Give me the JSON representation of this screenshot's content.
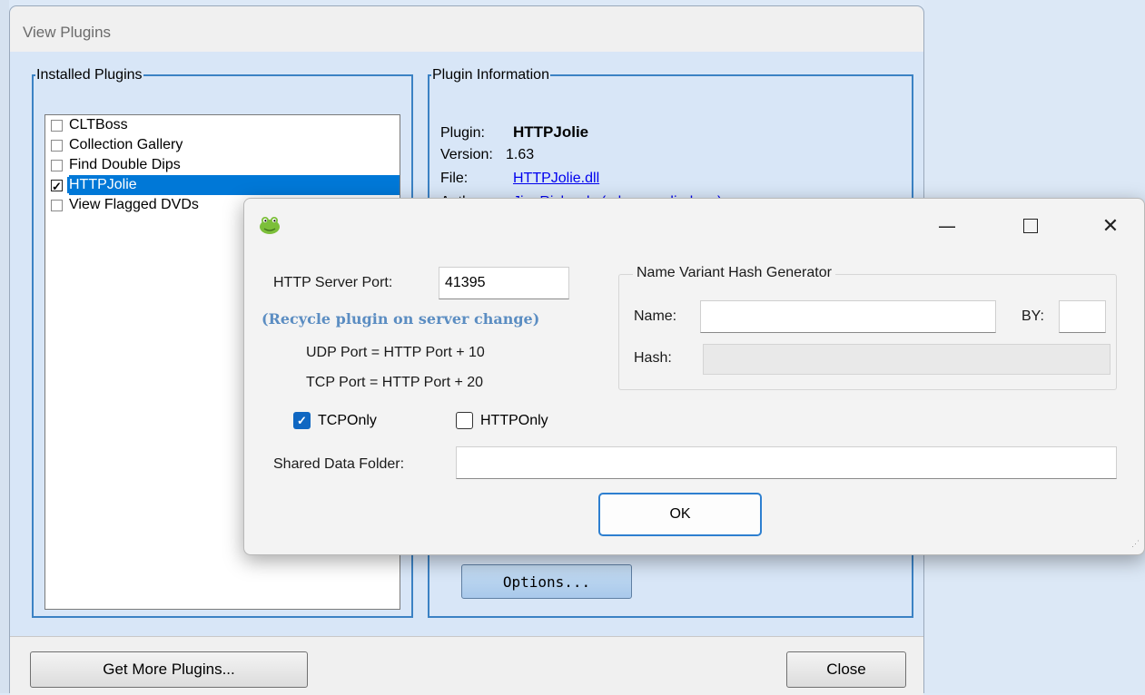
{
  "view_plugins": {
    "title": "View Plugins",
    "installed_group_label": "Installed Plugins",
    "plugins": [
      {
        "name": "CLTBoss",
        "checked": false,
        "selected": false
      },
      {
        "name": "Collection Gallery",
        "checked": false,
        "selected": false
      },
      {
        "name": "Find Double Dips",
        "checked": false,
        "selected": false
      },
      {
        "name": "HTTPJolie",
        "checked": true,
        "selected": true
      },
      {
        "name": "View Flagged DVDs",
        "checked": false,
        "selected": false
      }
    ],
    "info_group_label": "Plugin Information",
    "info": {
      "plugin_label": "Plugin:",
      "plugin_value": "HTTPJolie",
      "version_label": "Version:",
      "version_value": "1.63",
      "file_label": "File:",
      "file_value": "HTTPJolie.dll",
      "author_label": "Author:",
      "author_value": "Jim Richards (a.k.a. mediadogg)"
    },
    "options_button": "Options...",
    "get_more_button": "Get More Plugins...",
    "close_button": "Close"
  },
  "dialog": {
    "window_controls": {
      "minimize": "—",
      "close": "✕"
    },
    "http_port_label": "HTTP Server Port:",
    "http_port_value": "41395",
    "recycle_note": "(Recycle plugin on server change)",
    "udp_note": "UDP Port = HTTP Port  + 10",
    "tcp_note": "TCP Port = HTTP Port + 20",
    "tcp_only_label": "TCPOnly",
    "tcp_only_checked": true,
    "http_only_label": "HTTPOnly",
    "http_only_checked": false,
    "hash_group_label": "Name Variant Hash Generator",
    "name_label": "Name:",
    "name_value": "",
    "by_label": "BY:",
    "by_value": "",
    "hash_label": "Hash:",
    "hash_value": "",
    "shared_folder_label": "Shared Data Folder:",
    "shared_folder_value": "",
    "ok_button": "OK",
    "accent_color": "#0f67c2",
    "note_color": "#5b8dc2"
  }
}
